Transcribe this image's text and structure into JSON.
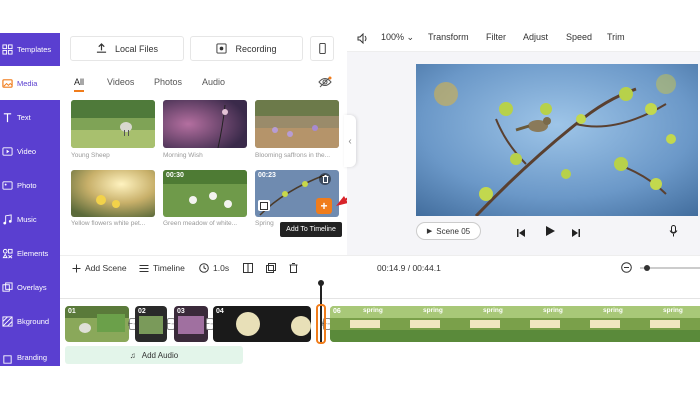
{
  "sidebar": {
    "items": [
      {
        "label": "Templates",
        "icon": "templates-icon"
      },
      {
        "label": "Media",
        "icon": "media-icon",
        "active": true
      },
      {
        "label": "Text",
        "icon": "text-icon"
      },
      {
        "label": "Video",
        "icon": "video-icon"
      },
      {
        "label": "Photo",
        "icon": "photo-icon"
      },
      {
        "label": "Music",
        "icon": "music-icon"
      },
      {
        "label": "Elements",
        "icon": "elements-icon"
      },
      {
        "label": "Overlays",
        "icon": "overlays-icon"
      },
      {
        "label": "Bkground",
        "icon": "background-icon"
      },
      {
        "label": "Branding",
        "icon": "branding-icon"
      }
    ]
  },
  "media": {
    "local_files_label": "Local Files",
    "recording_label": "Recording",
    "tabs": [
      "All",
      "Videos",
      "Photos",
      "Audio"
    ],
    "thumbnails": [
      {
        "caption": "Young Sheep",
        "duration": ""
      },
      {
        "caption": "Morning Wish",
        "duration": ""
      },
      {
        "caption": "Blooming saffrons in the...",
        "duration": ""
      },
      {
        "caption": "Yellow flowers white pet...",
        "duration": ""
      },
      {
        "caption": "Green meadow of white...",
        "duration": "00:30"
      },
      {
        "caption": "Spring",
        "duration": "00:23"
      }
    ],
    "tooltip": "Add To Timeline",
    "add_symbol": "+"
  },
  "toolbar": {
    "zoom": "100%",
    "transform": "Transform",
    "filter": "Filter",
    "adjust": "Adjust",
    "speed": "Speed",
    "trim": "Trim"
  },
  "preview": {
    "scene_label": "Scene 05"
  },
  "timeline": {
    "add_scene": "Add Scene",
    "timeline_label": "Timeline",
    "duration": "1.0s",
    "time_readout": "00:14.9 / 00:44.1",
    "clips": [
      {
        "num": "01"
      },
      {
        "num": "02"
      },
      {
        "num": "03"
      },
      {
        "num": "04"
      },
      {
        "num": "06"
      }
    ],
    "spring_label": "spring",
    "add_audio": "Add Audio"
  },
  "colors": {
    "sidebar": "#5a3fd0",
    "accent": "#f07c1b",
    "audio_track": "#e3f5ea"
  }
}
